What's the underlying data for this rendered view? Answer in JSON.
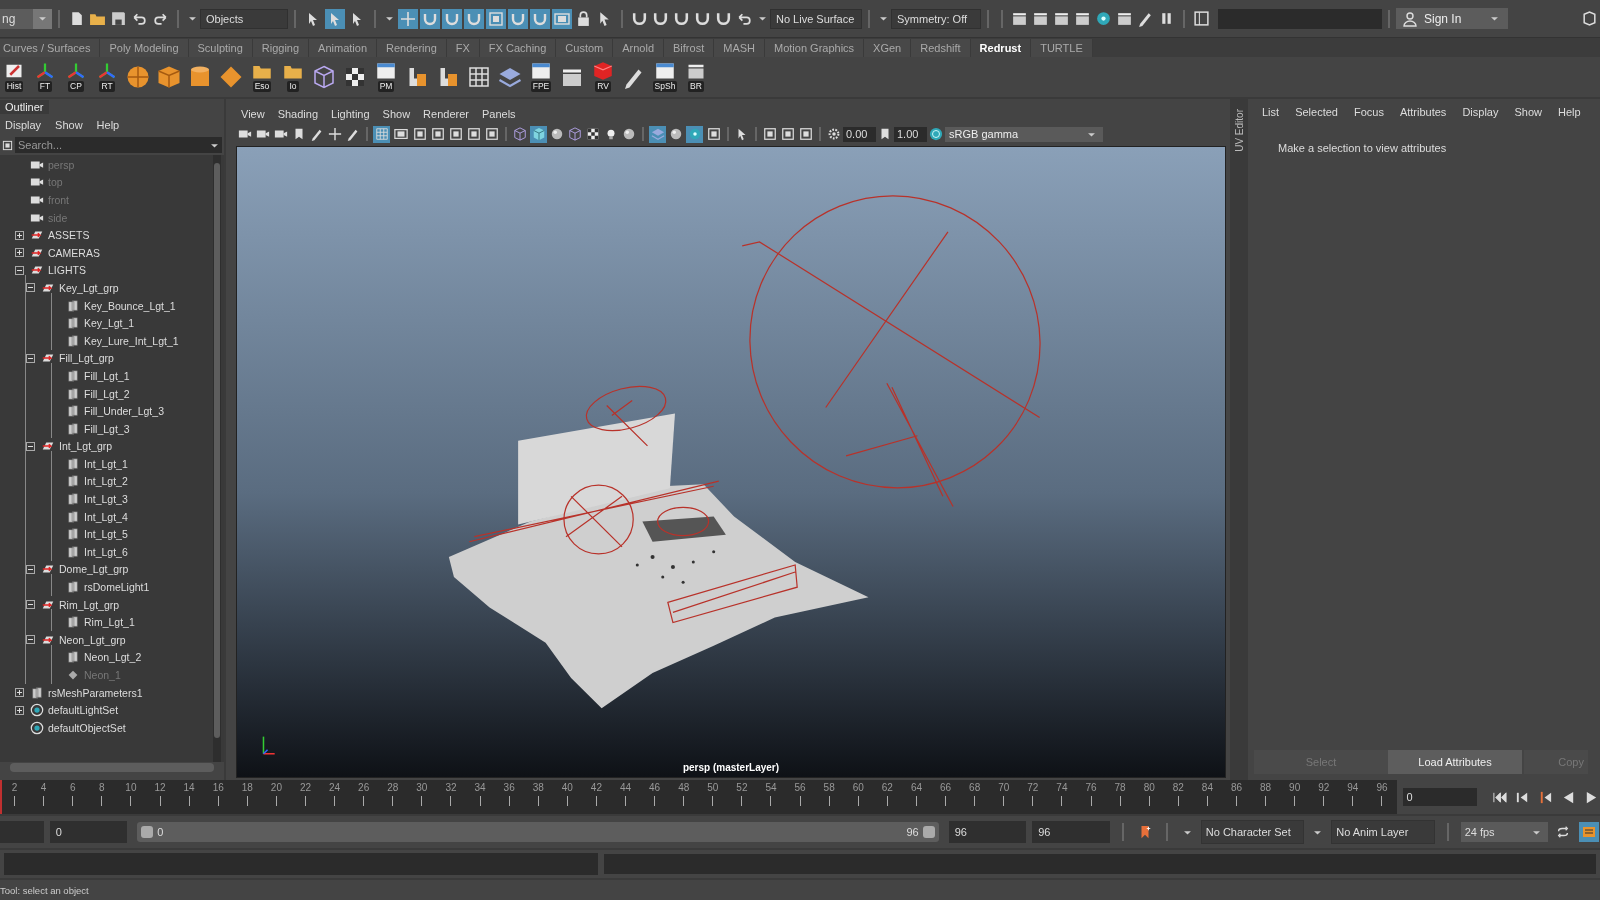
{
  "toolbar": {
    "menu_set": "ng",
    "select_mask": "Objects",
    "select_mode_buttons": [
      {
        "on": false
      },
      {
        "on": true
      },
      {
        "on": false
      }
    ],
    "snap_buttons": [
      {
        "on": true
      },
      {
        "on": true
      },
      {
        "on": true
      },
      {
        "on": true
      },
      {
        "on": true
      },
      {
        "on": true
      },
      {
        "on": true
      },
      {
        "on": true
      }
    ],
    "live_surface": "No Live Surface",
    "symmetry": "Symmetry: Off",
    "sign_in": "Sign In"
  },
  "shelf": {
    "tabs": [
      {
        "label": "Curves / Surfaces",
        "selected": false
      },
      {
        "label": "Poly Modeling",
        "selected": false
      },
      {
        "label": "Sculpting",
        "selected": false
      },
      {
        "label": "Rigging",
        "selected": false
      },
      {
        "label": "Animation",
        "selected": false
      },
      {
        "label": "Rendering",
        "selected": false
      },
      {
        "label": "FX",
        "selected": false
      },
      {
        "label": "FX Caching",
        "selected": false
      },
      {
        "label": "Custom",
        "selected": false
      },
      {
        "label": "Arnold",
        "selected": false
      },
      {
        "label": "Bifrost",
        "selected": false
      },
      {
        "label": "MASH",
        "selected": false
      },
      {
        "label": "Motion Graphics",
        "selected": false
      },
      {
        "label": "XGen",
        "selected": false
      },
      {
        "label": "Redshift",
        "selected": false
      },
      {
        "label": "Redrust",
        "selected": true
      },
      {
        "label": "TURTLE",
        "selected": false
      }
    ],
    "labels": [
      "Hist",
      "FT",
      "CP",
      "RT",
      "Eso",
      "Io",
      "PM",
      "FPE",
      "RV",
      "SpSh",
      "BR"
    ]
  },
  "outliner": {
    "title": "Outliner",
    "menu": [
      "Display",
      "Show",
      "Help"
    ],
    "search_placeholder": "Search...",
    "items": [
      {
        "label": "persp",
        "kind": "camera",
        "dimmed": true
      },
      {
        "label": "top",
        "kind": "camera",
        "dimmed": true
      },
      {
        "label": "front",
        "kind": "camera",
        "dimmed": true
      },
      {
        "label": "side",
        "kind": "camera",
        "dimmed": true
      },
      {
        "label": "ASSETS",
        "kind": "group",
        "dimmed": false,
        "expanded": false
      },
      {
        "label": "CAMERAS",
        "kind": "group",
        "dimmed": false,
        "expanded": false
      },
      {
        "label": "LIGHTS",
        "kind": "group",
        "dimmed": false,
        "expanded": true,
        "children": [
          {
            "label": "Key_Lgt_grp",
            "kind": "group",
            "dimmed": false,
            "expanded": true,
            "children": [
              {
                "label": "Key_Bounce_Lgt_1",
                "kind": "light",
                "dimmed": false
              },
              {
                "label": "Key_Lgt_1",
                "kind": "light",
                "dimmed": false
              },
              {
                "label": "Key_Lure_Int_Lgt_1",
                "kind": "light",
                "dimmed": false
              }
            ]
          },
          {
            "label": "Fill_Lgt_grp",
            "kind": "group",
            "dimmed": false,
            "expanded": true,
            "children": [
              {
                "label": "Fill_Lgt_1",
                "kind": "light",
                "dimmed": false
              },
              {
                "label": "Fill_Lgt_2",
                "kind": "light",
                "dimmed": false
              },
              {
                "label": "Fill_Under_Lgt_3",
                "kind": "light",
                "dimmed": false
              },
              {
                "label": "Fill_Lgt_3",
                "kind": "light",
                "dimmed": false
              }
            ]
          },
          {
            "label": "Int_Lgt_grp",
            "kind": "group",
            "dimmed": false,
            "expanded": true,
            "children": [
              {
                "label": "Int_Lgt_1",
                "kind": "light",
                "dimmed": false
              },
              {
                "label": "Int_Lgt_2",
                "kind": "light",
                "dimmed": false
              },
              {
                "label": "Int_Lgt_3",
                "kind": "light",
                "dimmed": false
              },
              {
                "label": "Int_Lgt_4",
                "kind": "light",
                "dimmed": false
              },
              {
                "label": "Int_Lgt_5",
                "kind": "light",
                "dimmed": false
              },
              {
                "label": "Int_Lgt_6",
                "kind": "light",
                "dimmed": false
              }
            ]
          },
          {
            "label": "Dome_Lgt_grp",
            "kind": "group",
            "dimmed": false,
            "expanded": true,
            "children": [
              {
                "label": "rsDomeLight1",
                "kind": "light",
                "dimmed": false
              }
            ]
          },
          {
            "label": "Rim_Lgt_grp",
            "kind": "group",
            "dimmed": false,
            "expanded": true,
            "children": [
              {
                "label": "Rim_Lgt_1",
                "kind": "light",
                "dimmed": false
              }
            ]
          },
          {
            "label": "Neon_Lgt_grp",
            "kind": "group",
            "dimmed": false,
            "expanded": true,
            "children": [
              {
                "label": "Neon_Lgt_2",
                "kind": "light",
                "dimmed": false
              },
              {
                "label": "Neon_1",
                "kind": "mesh",
                "dimmed": true
              }
            ]
          }
        ]
      },
      {
        "label": "rsMeshParameters1",
        "kind": "light",
        "dimmed": false,
        "expanded": false
      },
      {
        "label": "defaultLightSet",
        "kind": "set",
        "dimmed": false,
        "expanded": false
      },
      {
        "label": "defaultObjectSet",
        "kind": "set",
        "dimmed": false
      }
    ]
  },
  "viewport": {
    "menu": [
      "View",
      "Shading",
      "Lighting",
      "Show",
      "Renderer",
      "Panels"
    ],
    "toggles": [
      {
        "on": true
      },
      {
        "on": false
      },
      {
        "on": false
      },
      {
        "on": true
      },
      {
        "on": true
      },
      {
        "on": false
      },
      {
        "on": true
      }
    ],
    "exposure": "0.00",
    "gamma": "1.00",
    "color_space": "sRGB gamma",
    "camera_label": "persp (masterLayer)"
  },
  "side_tab": "UV Editor",
  "attribute_editor": {
    "menu": [
      "List",
      "Selected",
      "Focus",
      "Attributes",
      "Display",
      "Show",
      "Help"
    ],
    "message": "Make a selection to view attributes",
    "buttons": [
      {
        "label": "Select",
        "disabled": true
      },
      {
        "label": "Load Attributes",
        "disabled": false
      },
      {
        "label": "Copy",
        "disabled": true
      }
    ]
  },
  "timeline": {
    "ticks": [
      "2",
      "4",
      "6",
      "8",
      "10",
      "12",
      "14",
      "16",
      "18",
      "20",
      "22",
      "24",
      "26",
      "28",
      "30",
      "32",
      "34",
      "36",
      "38",
      "40",
      "42",
      "44",
      "46",
      "48",
      "50",
      "52",
      "54",
      "56",
      "58",
      "60",
      "62",
      "64",
      "66",
      "68",
      "70",
      "72",
      "74",
      "76",
      "78",
      "80",
      "82",
      "84",
      "86",
      "88",
      "90",
      "92",
      "94",
      "96"
    ],
    "current_frame": "0",
    "level": 0
  },
  "range": {
    "start": "0",
    "slider_start": "0",
    "slider_end": "96",
    "end": "96",
    "playback_end": "96",
    "level": 1
  },
  "character_set": "No Character Set",
  "anim_layer": "No Anim Layer",
  "fps": "24 fps",
  "help_line": "Tool: select an object"
}
